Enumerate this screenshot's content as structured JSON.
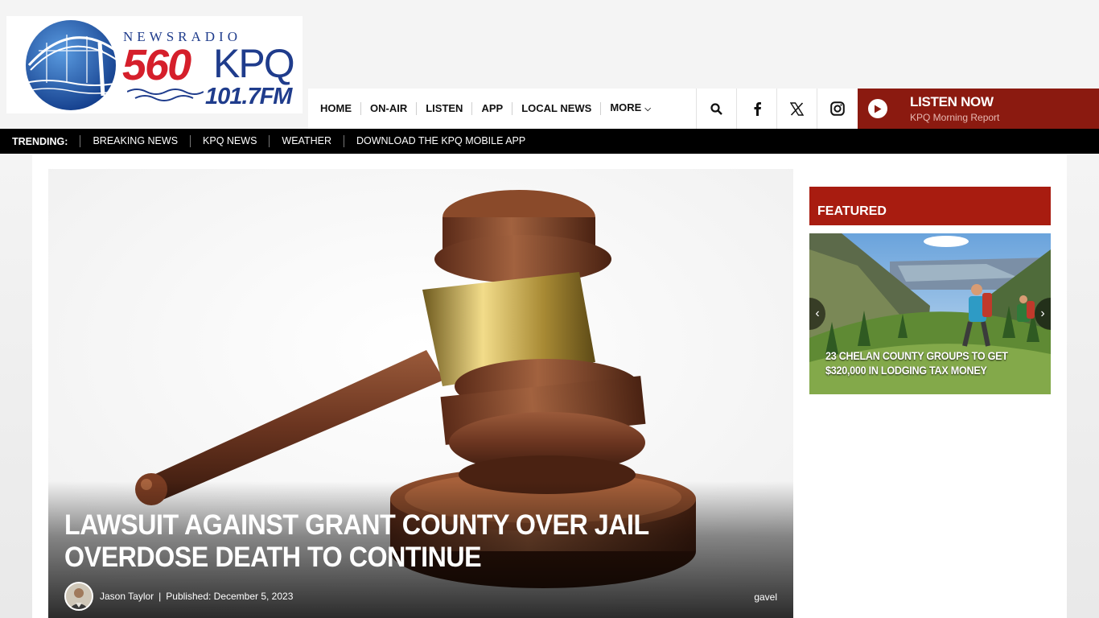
{
  "logo": {
    "newsradio": "NEWSRADIO",
    "number": "560",
    "call": "KPQ",
    "fm": "101.7FM"
  },
  "nav": {
    "items": [
      {
        "label": "HOME"
      },
      {
        "label": "ON-AIR"
      },
      {
        "label": "LISTEN"
      },
      {
        "label": "APP"
      },
      {
        "label": "LOCAL NEWS"
      },
      {
        "label": "MORE"
      }
    ],
    "icons": [
      "search-icon",
      "facebook-icon",
      "x-icon",
      "instagram-icon"
    ]
  },
  "listen": {
    "title": "LISTEN NOW",
    "subtitle": "KPQ Morning Report"
  },
  "trending": {
    "label": "TRENDING:",
    "items": [
      {
        "label": "BREAKING NEWS"
      },
      {
        "label": "KPQ NEWS"
      },
      {
        "label": "WEATHER"
      },
      {
        "label": "DOWNLOAD THE KPQ MOBILE APP"
      }
    ]
  },
  "hero": {
    "title": "LAWSUIT AGAINST GRANT COUNTY OVER JAIL OVERDOSE DEATH TO CONTINUE",
    "author": "Jason Taylor",
    "separator": "|",
    "published": "Published: December 5, 2023",
    "image_credit": "gavel"
  },
  "featured": {
    "heading": "FEATURED",
    "card_title": "23 CHELAN COUNTY GROUPS TO GET $320,000 IN LODGING TAX MONEY"
  },
  "colors": {
    "brand_red": "#8b1a10",
    "featured_red": "#a81c10",
    "logo_blue": "#1f3c8c",
    "logo_red": "#d51f2b"
  }
}
